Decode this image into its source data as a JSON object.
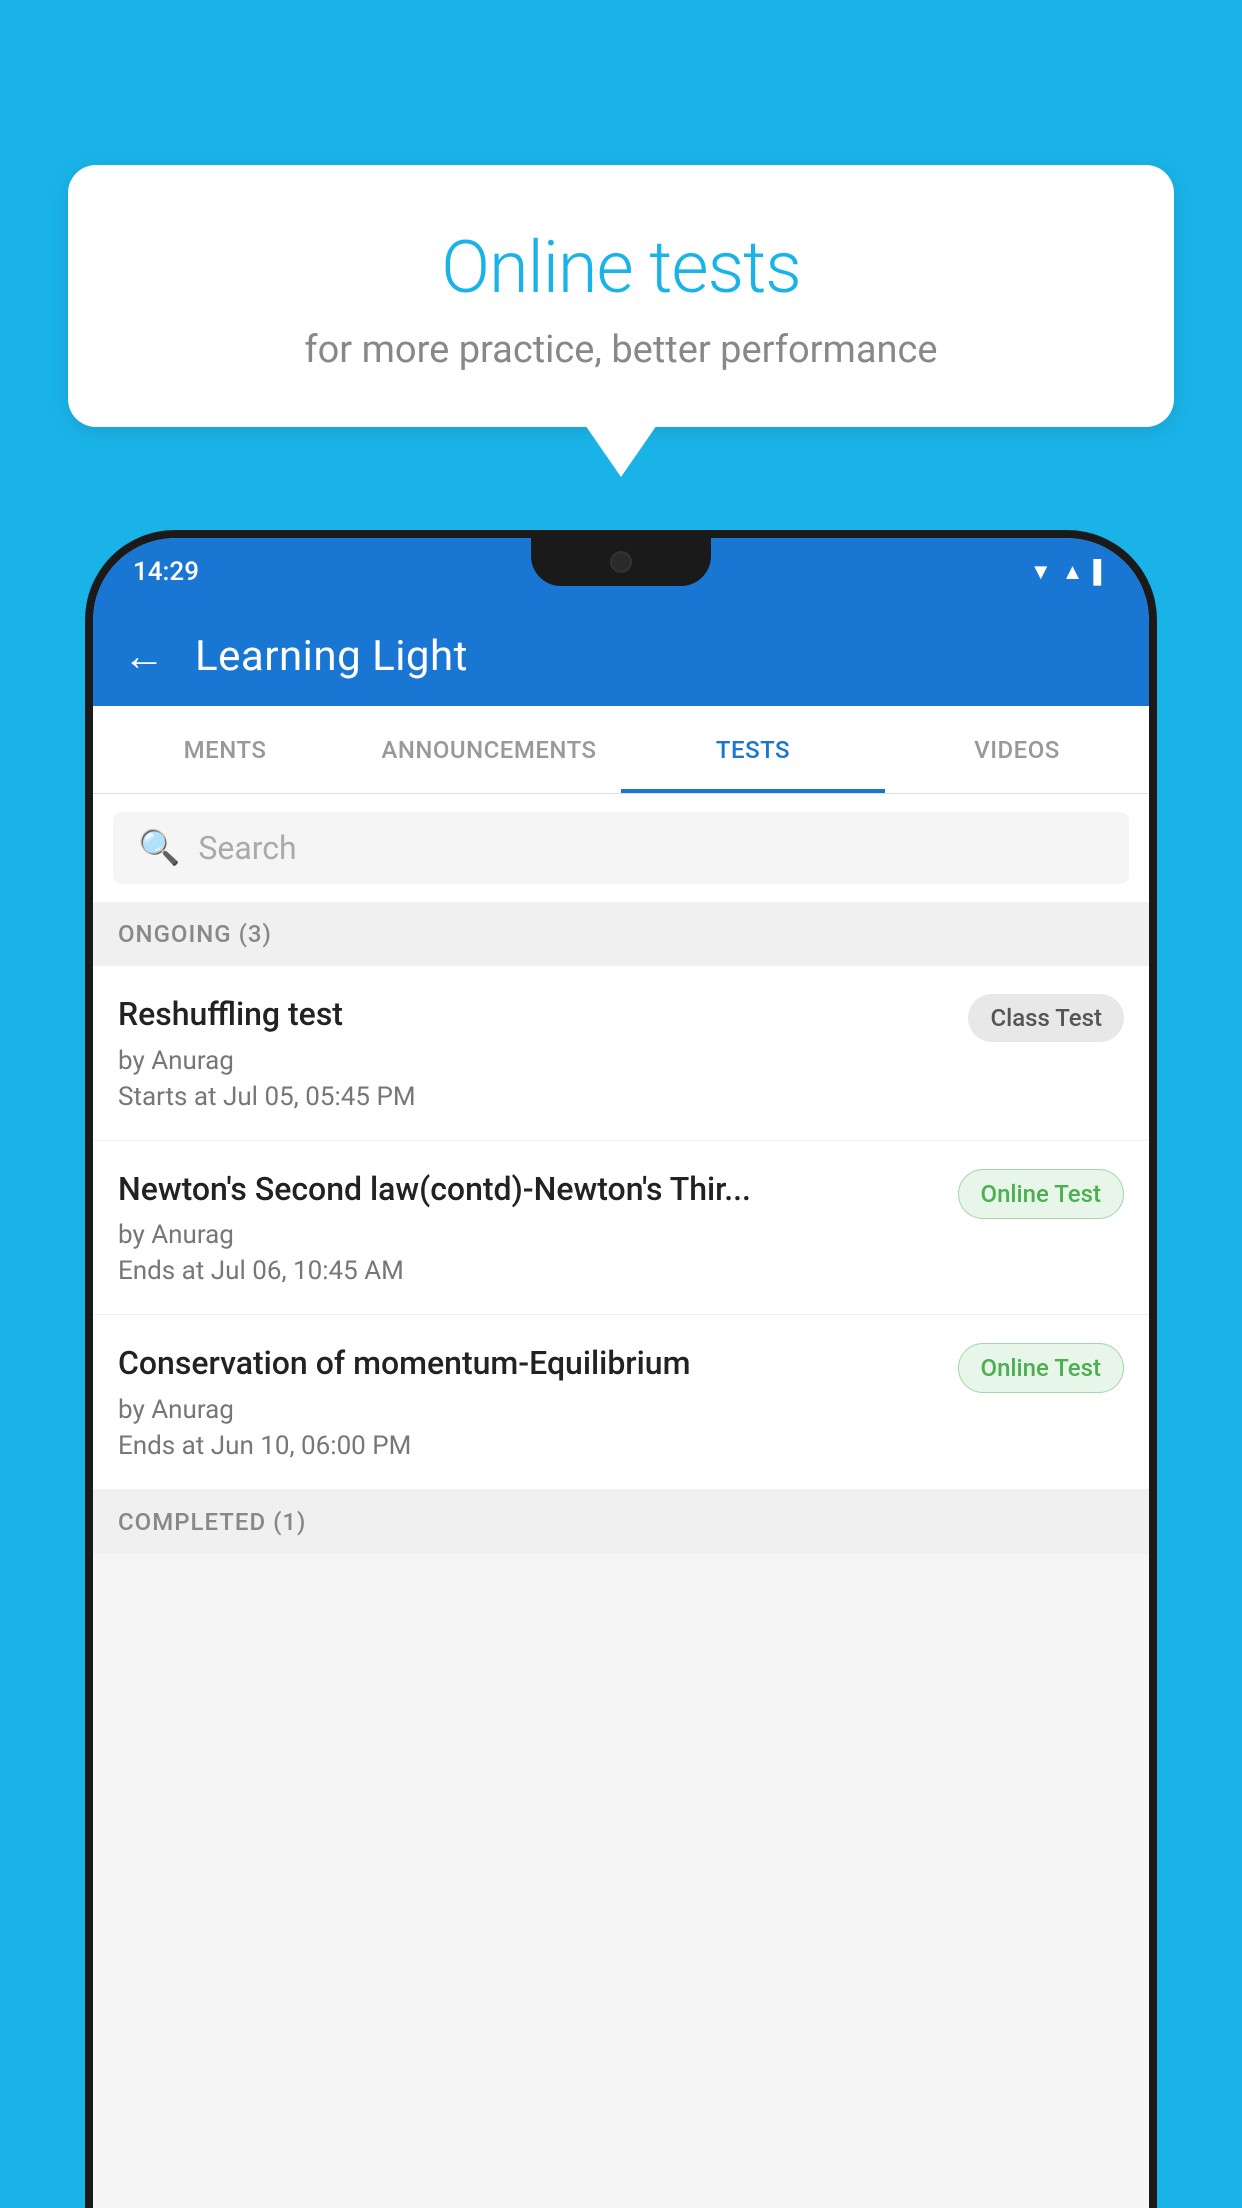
{
  "background": {
    "color": "#1ab3e8"
  },
  "speech_bubble": {
    "title": "Online tests",
    "subtitle": "for more practice, better performance"
  },
  "phone": {
    "status_bar": {
      "time": "14:29",
      "icons": [
        "wifi",
        "signal",
        "battery"
      ]
    },
    "app_bar": {
      "title": "Learning Light",
      "back_label": "←"
    },
    "tabs": [
      {
        "label": "MENTS",
        "active": false
      },
      {
        "label": "ANNOUNCEMENTS",
        "active": false
      },
      {
        "label": "TESTS",
        "active": true
      },
      {
        "label": "VIDEOS",
        "active": false
      }
    ],
    "search": {
      "placeholder": "Search"
    },
    "sections": [
      {
        "header": "ONGOING (3)",
        "tests": [
          {
            "title": "Reshuffling test",
            "author": "by Anurag",
            "date": "Starts at  Jul 05, 05:45 PM",
            "badge": "Class Test",
            "badge_type": "class"
          },
          {
            "title": "Newton's Second law(contd)-Newton's Thir...",
            "author": "by Anurag",
            "date": "Ends at  Jul 06, 10:45 AM",
            "badge": "Online Test",
            "badge_type": "online"
          },
          {
            "title": "Conservation of momentum-Equilibrium",
            "author": "by Anurag",
            "date": "Ends at  Jun 10, 06:00 PM",
            "badge": "Online Test",
            "badge_type": "online"
          }
        ]
      },
      {
        "header": "COMPLETED (1)",
        "tests": []
      }
    ]
  }
}
